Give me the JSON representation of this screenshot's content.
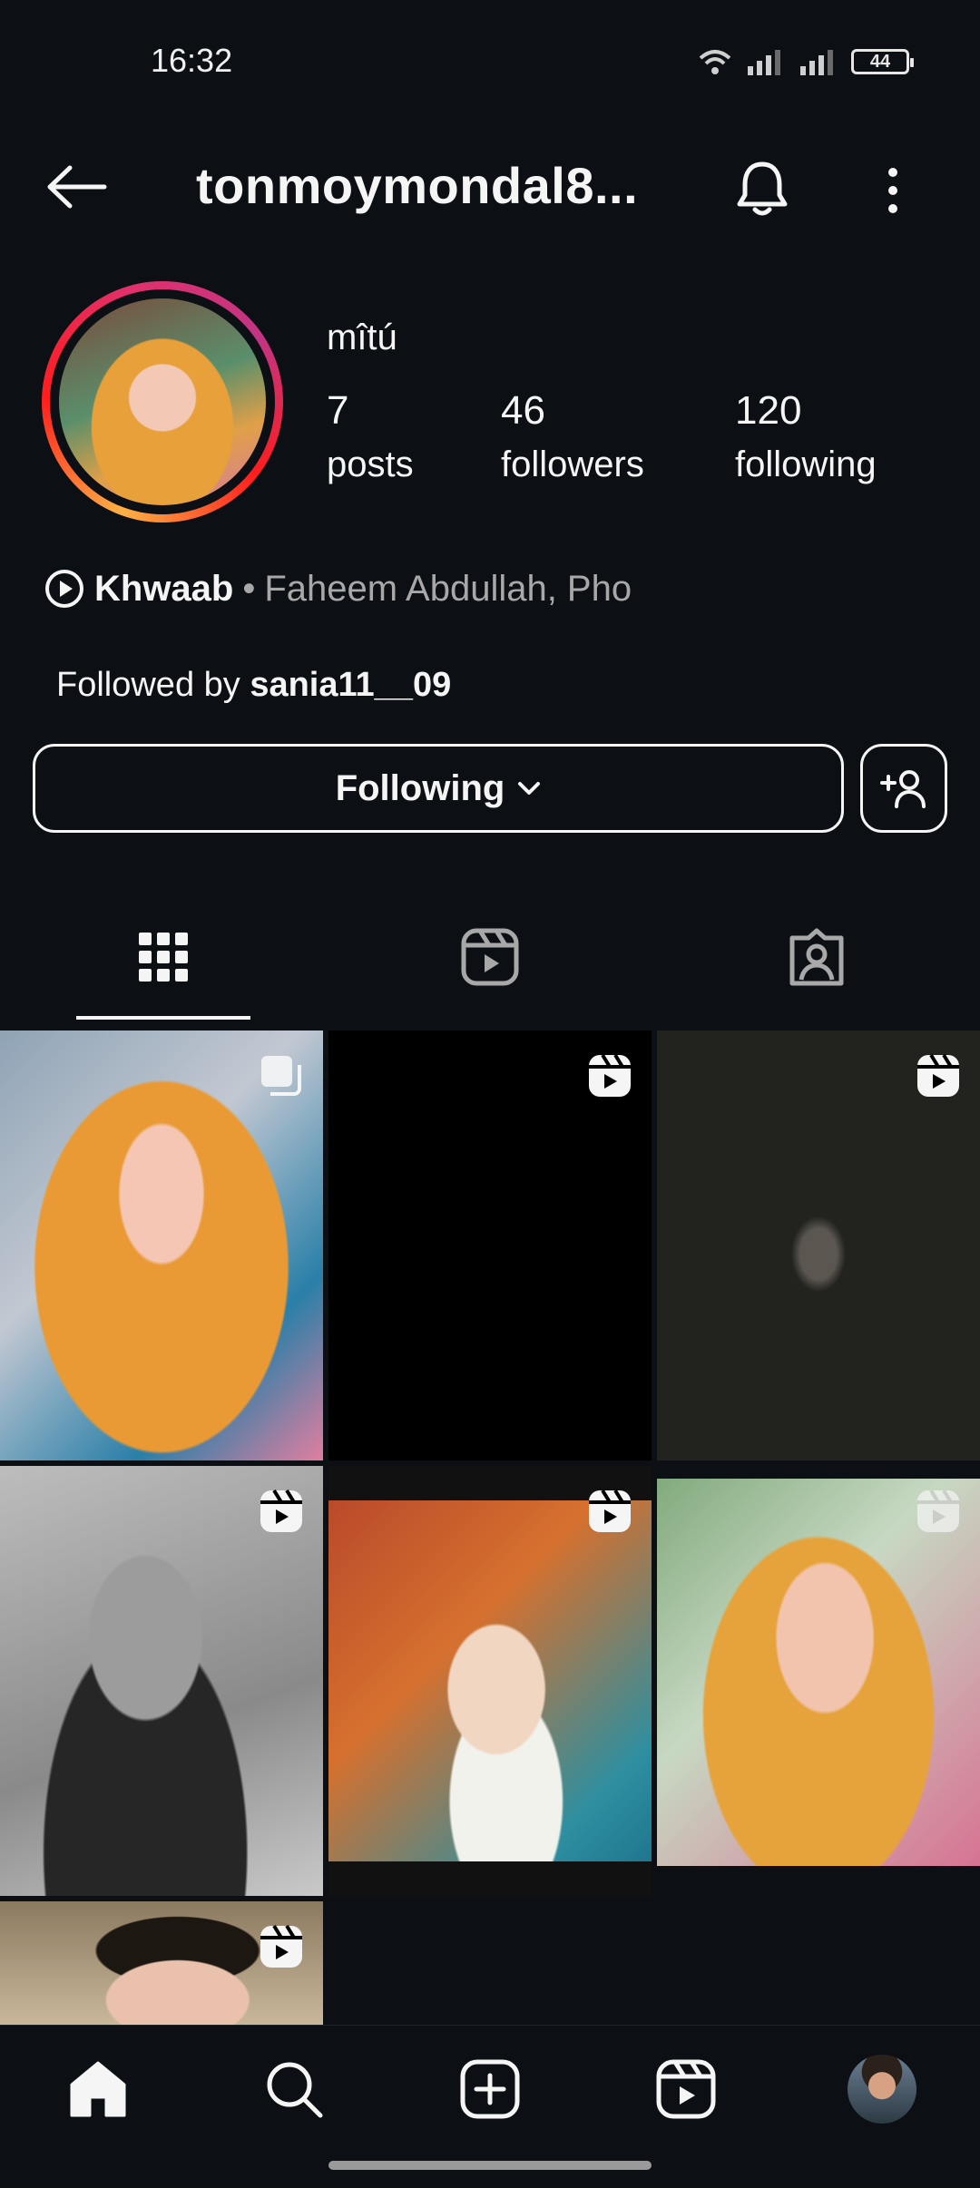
{
  "status_bar": {
    "time": "16:32",
    "battery": "44"
  },
  "header": {
    "username": "tonmoymondal8..."
  },
  "profile": {
    "display_name": "mîtú",
    "stats": [
      {
        "value": "7",
        "label": "posts"
      },
      {
        "value": "46",
        "label": "followers"
      },
      {
        "value": "120",
        "label": "following"
      }
    ],
    "music": {
      "song": "Khwaab",
      "separator": "•",
      "artist": "Faheem Abdullah, Pho"
    },
    "followed_by_prefix": "Followed by",
    "followed_by_user": "sania11__09"
  },
  "actions": {
    "following_label": "Following"
  },
  "tabs": [
    {
      "name": "grid",
      "icon": "grid-icon",
      "active": true
    },
    {
      "name": "reels",
      "icon": "reels-icon",
      "active": false
    },
    {
      "name": "tagged",
      "icon": "tagged-icon",
      "active": false
    }
  ],
  "posts": [
    {
      "type": "carousel",
      "icon": "carousel-icon"
    },
    {
      "type": "reel",
      "icon": "reel-icon"
    },
    {
      "type": "reel",
      "icon": "reel-icon"
    },
    {
      "type": "reel",
      "icon": "reel-icon"
    },
    {
      "type": "reel",
      "icon": "reel-icon"
    },
    {
      "type": "reel",
      "icon": "reel-icon"
    },
    {
      "type": "reel",
      "icon": "reel-icon"
    }
  ],
  "bottom_nav": [
    {
      "name": "home",
      "icon": "home-icon"
    },
    {
      "name": "search",
      "icon": "search-icon"
    },
    {
      "name": "create",
      "icon": "add-post-icon"
    },
    {
      "name": "reels",
      "icon": "reels-icon"
    },
    {
      "name": "profile",
      "icon": "profile-avatar"
    }
  ],
  "colors": {
    "background": "#0c1014",
    "text": "#f5f5f5",
    "secondary_text": "#a8a8a8"
  }
}
